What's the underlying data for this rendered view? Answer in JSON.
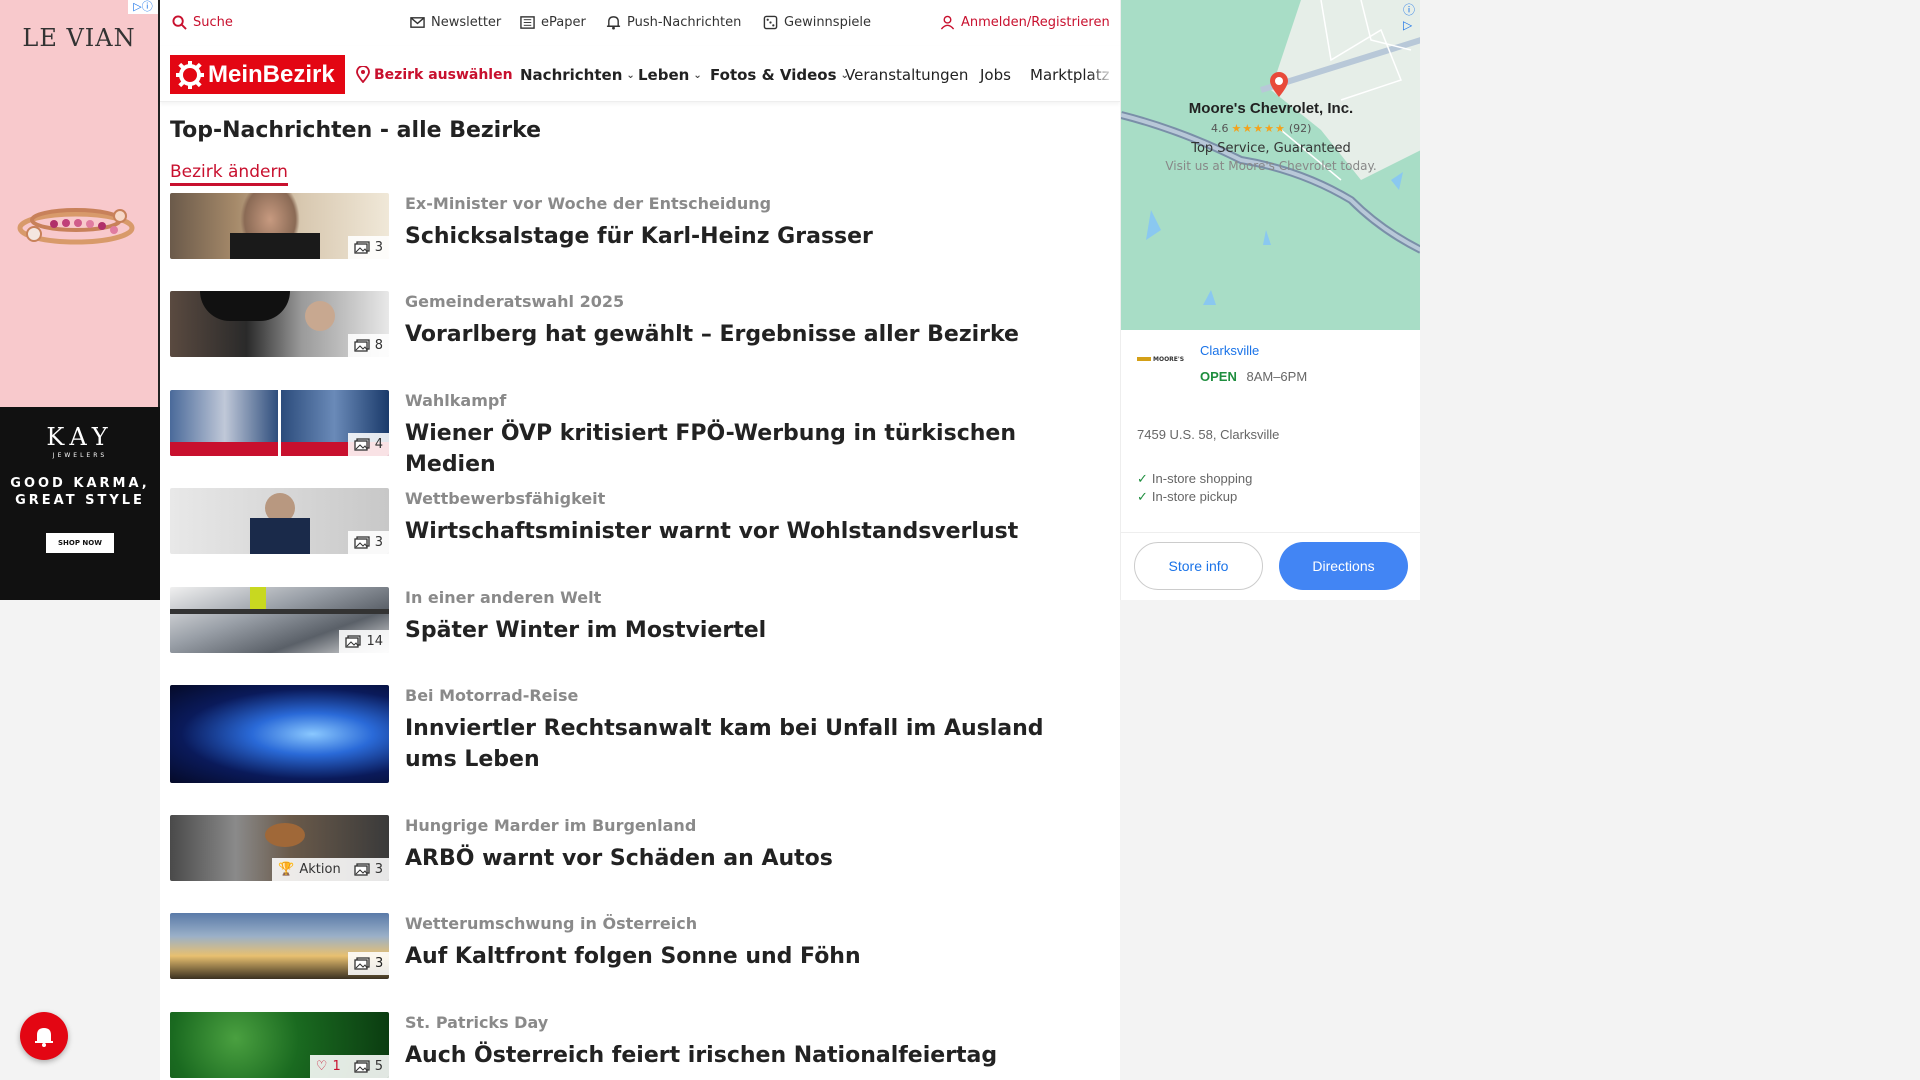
{
  "left_ad": {
    "brand": "LE VIAN",
    "kay_brand": "KAY",
    "kay_sub": "JEWELERS",
    "slogan_line1": "GOOD KARMA,",
    "slogan_line2": "GREAT STYLE",
    "shop_label": "SHOP NOW"
  },
  "topbar": {
    "search": "Suche",
    "newsletter": "Newsletter",
    "epaper": "ePaper",
    "push": "Push-Nachrichten",
    "games": "Gewinnspiele",
    "login": "Anmelden/Registrieren"
  },
  "nav": {
    "logo": "MeinBezirk",
    "bezirk": "Bezirk auswählen",
    "items": [
      "Nachrichten",
      "Leben",
      "Fotos & Videos",
      "Veranstaltungen",
      "Jobs",
      "Marktplatz"
    ]
  },
  "page": {
    "title": "Top-Nachrichten - alle Bezirke",
    "change_link": "Bezirk ändern"
  },
  "articles": [
    {
      "kicker": "Ex-Minister vor Woche der Entscheidung",
      "headline": "Schicksalstage für Karl-Heinz Grasser",
      "photos": "3"
    },
    {
      "kicker": "Gemeinderatswahl 2025",
      "headline": "Vorarlberg hat gewählt – Ergebnisse aller Bezirke",
      "photos": "8"
    },
    {
      "kicker": "Wahlkampf",
      "headline": "Wiener ÖVP kritisiert FPÖ-Werbung in türkischen Medien",
      "photos": "4"
    },
    {
      "kicker": "Wettbewerbsfähigkeit",
      "headline": "Wirtschaftsminister warnt vor Wohlstandsverlust",
      "photos": "3"
    },
    {
      "kicker": "In einer anderen Welt",
      "headline": "Später Winter im Mostviertel",
      "photos": "14"
    },
    {
      "kicker": "Bei Motorrad-Reise",
      "headline": "Innviertler Rechtsanwalt kam bei Unfall im Ausland ums Leben",
      "photos": ""
    },
    {
      "kicker": "Hungrige Marder im Burgenland",
      "headline": "ARBÖ warnt vor Schäden an Autos",
      "photos": "3",
      "extra": "Aktion"
    },
    {
      "kicker": "Wetterumschwung in Österreich",
      "headline": "Auf Kaltfront folgen Sonne und Föhn",
      "photos": "3"
    },
    {
      "kicker": "St. Patricks Day",
      "headline": "Auch Österreich feiert irischen Nationalfeiertag",
      "photos": "5",
      "likes": "1"
    }
  ],
  "map_ad": {
    "name": "Moore's Chevrolet, Inc.",
    "rating": "4.6",
    "reviews": "(92)",
    "tagline": "Top Service, Guaranteed",
    "sub": "Visit us at Moore's Chevrolet today.",
    "store_logo": "MOORE'S",
    "city": "Clarksville",
    "open": "OPEN",
    "hours": "8AM–6PM",
    "address": "7459 U.S. 58, Clarksville",
    "features": [
      "In-store shopping",
      "In-store pickup"
    ],
    "btn_store": "Store info",
    "btn_directions": "Directions"
  },
  "colors": {
    "brand_red": "#e30613",
    "link_blue": "#1a73e8",
    "button_blue": "#4285f4",
    "open_green": "#1e8e3e"
  }
}
